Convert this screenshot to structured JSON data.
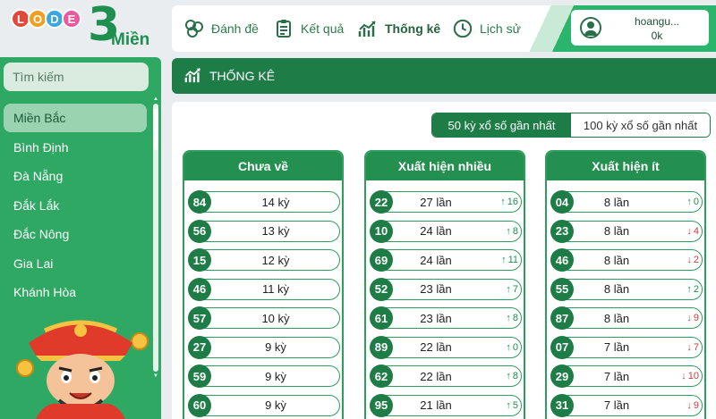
{
  "logo": {
    "balls": [
      {
        "letter": "L",
        "color": "#e04a3c"
      },
      {
        "letter": "O",
        "color": "#f0a020"
      },
      {
        "letter": "D",
        "color": "#3aa7e0"
      },
      {
        "letter": "E",
        "color": "#e85aa0"
      }
    ],
    "digit": "3",
    "word": "Miền"
  },
  "nav": {
    "items": [
      {
        "label": "Đánh đề",
        "icon": "dice-icon"
      },
      {
        "label": "Kết quả",
        "icon": "clipboard-icon"
      },
      {
        "label": "Thống kê",
        "icon": "chart-line-icon"
      },
      {
        "label": "Lịch sử",
        "icon": "clock-icon"
      }
    ],
    "active": "Thống kê"
  },
  "user": {
    "name": "hoangu...",
    "balance": "0k"
  },
  "sidebar": {
    "search_placeholder": "Tìm kiếm",
    "items": [
      "Miền Bắc",
      "Bình Định",
      "Đà Nẵng",
      "Đắk Lắk",
      "Đắc Nông",
      "Gia Lai",
      "Khánh Hòa"
    ],
    "active_index": 0
  },
  "section": {
    "title": "THỐNG KÊ"
  },
  "toggle": {
    "option1": "50 kỳ xổ số gần nhất",
    "option2": "100 kỳ xổ số gần nhất",
    "selected": 0
  },
  "panels": [
    {
      "title": "Chưa về",
      "rows": [
        {
          "num": "84",
          "value": "14 kỳ"
        },
        {
          "num": "56",
          "value": "13 kỳ"
        },
        {
          "num": "15",
          "value": "12 kỳ"
        },
        {
          "num": "46",
          "value": "11 kỳ"
        },
        {
          "num": "57",
          "value": "10 kỳ"
        },
        {
          "num": "27",
          "value": "9 kỳ"
        },
        {
          "num": "59",
          "value": "9 kỳ"
        },
        {
          "num": "60",
          "value": "9 kỳ"
        }
      ]
    },
    {
      "title": "Xuất hiện nhiều",
      "rows": [
        {
          "num": "22",
          "value": "27 lần",
          "change": "16",
          "dir": "up"
        },
        {
          "num": "10",
          "value": "24 lần",
          "change": "8",
          "dir": "up"
        },
        {
          "num": "69",
          "value": "24 lần",
          "change": "11",
          "dir": "up"
        },
        {
          "num": "52",
          "value": "23 lần",
          "change": "7",
          "dir": "up"
        },
        {
          "num": "61",
          "value": "23 lần",
          "change": "8",
          "dir": "up"
        },
        {
          "num": "89",
          "value": "22 lần",
          "change": "0",
          "dir": "up"
        },
        {
          "num": "62",
          "value": "22 lần",
          "change": "8",
          "dir": "up"
        },
        {
          "num": "95",
          "value": "21 lần",
          "change": "5",
          "dir": "up"
        }
      ]
    },
    {
      "title": "Xuất hiện ít",
      "rows": [
        {
          "num": "04",
          "value": "8 lần",
          "change": "0",
          "dir": "up"
        },
        {
          "num": "23",
          "value": "8 lần",
          "change": "4",
          "dir": "down"
        },
        {
          "num": "46",
          "value": "8 lần",
          "change": "2",
          "dir": "down"
        },
        {
          "num": "55",
          "value": "8 lần",
          "change": "2",
          "dir": "up"
        },
        {
          "num": "87",
          "value": "8 lần",
          "change": "9",
          "dir": "down"
        },
        {
          "num": "07",
          "value": "7 lần",
          "change": "7",
          "dir": "down"
        },
        {
          "num": "29",
          "value": "7 lần",
          "change": "10",
          "dir": "down"
        },
        {
          "num": "31",
          "value": "7 lần",
          "change": "9",
          "dir": "down"
        }
      ]
    }
  ]
}
